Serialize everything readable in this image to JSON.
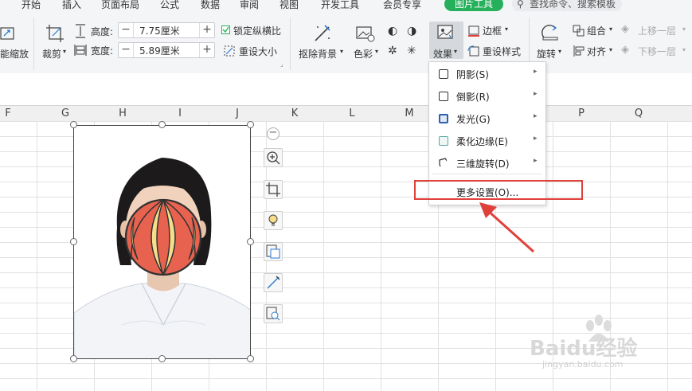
{
  "menu": {
    "tabs": [
      "开始",
      "插入",
      "页面布局",
      "公式",
      "数据",
      "审阅",
      "视图",
      "开发工具",
      "会员专享"
    ],
    "picture_tools": "图片工具",
    "search_placeholder": "查找命令、搜索模板"
  },
  "ribbon": {
    "smart_zoom": "能缩放",
    "crop": "裁剪",
    "height_label": "高度:",
    "height_value": "7.75厘米",
    "width_label": "宽度:",
    "width_value": "5.89厘米",
    "lock_ratio": "锁定纵横比",
    "reset_size": "重设大小",
    "remove_bg": "抠除背景",
    "color": "色彩",
    "effects": "效果",
    "border": "边框",
    "reset_style": "重设样式",
    "rotate": "旋转",
    "group": "组合",
    "align": "对齐",
    "bring_forward": "上移一层",
    "send_backward": "下移一层",
    "minus": "−",
    "plus": "+"
  },
  "columns": [
    "F",
    "G",
    "H",
    "I",
    "J",
    "K",
    "L",
    "M",
    "N",
    "O",
    "P",
    "Q"
  ],
  "dropdown": {
    "items": [
      {
        "label": "阴影(S)",
        "icon": "shadow-icon"
      },
      {
        "label": "倒影(R)",
        "icon": "reflection-icon"
      },
      {
        "label": "发光(G)",
        "icon": "glow-icon"
      },
      {
        "label": "柔化边缘(E)",
        "icon": "soft-edge-icon"
      },
      {
        "label": "三维旋转(D)",
        "icon": "3d-rotation-icon"
      }
    ],
    "more": "更多设置(O)..."
  },
  "watermark": {
    "brand": "Baidu经验",
    "url": "jingyan.baidu.com"
  },
  "colors": {
    "accent_green": "#27b05c",
    "highlight_red": "#e0403a",
    "ball_red": "#e8634f",
    "ball_yellow": "#f6dd8b"
  }
}
